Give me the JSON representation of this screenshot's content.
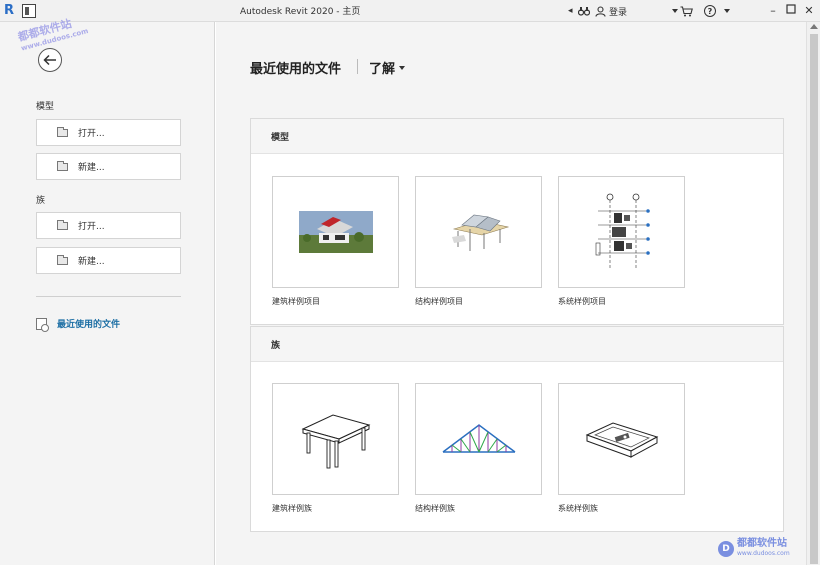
{
  "titlebar": {
    "title": "Autodesk Revit 2020 - 主页",
    "login_label": "登录",
    "help_label": "?"
  },
  "sidebar": {
    "model_section": "模型",
    "family_section": "族",
    "open_label": "打开...",
    "new_label": "新建...",
    "recent_label": "最近使用的文件"
  },
  "main": {
    "title": "最近使用的文件",
    "learn_label": "了解",
    "model_card": {
      "header": "模型",
      "tiles": [
        "建筑样例项目",
        "结构样例项目",
        "系统样例项目"
      ]
    },
    "family_card": {
      "header": "族",
      "tiles": [
        "建筑样例族",
        "结构样例族",
        "系统样例族"
      ]
    }
  },
  "watermark": {
    "name": "都都软件站",
    "url": "www.dudoos.com",
    "badge": "D"
  },
  "colors": {
    "accent_link": "#1d6fa5",
    "logo_blue": "#2b6ec6",
    "watermark": "#7a8fe0"
  },
  "icons": {
    "back": "arrow-left-icon",
    "folder": "folder-icon",
    "recent": "recent-files-icon",
    "binoculars": "binoculars-icon",
    "user": "user-icon",
    "cart": "cart-icon",
    "help": "help-icon"
  }
}
